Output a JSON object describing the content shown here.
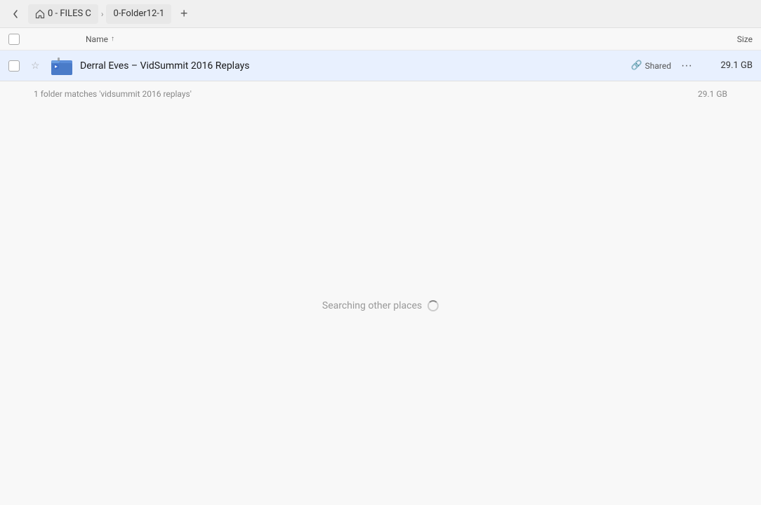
{
  "topbar": {
    "back_button_label": "←",
    "breadcrumbs": [
      {
        "id": "bc1",
        "label": "0 - FILES C"
      },
      {
        "id": "bc2",
        "label": "0-Folder12-1"
      }
    ],
    "add_tab_label": "+"
  },
  "columns": {
    "name_label": "Name",
    "sort_arrow": "↑",
    "size_label": "Size"
  },
  "file_row": {
    "name": "Derral Eves – VidSummit 2016 Replays",
    "shared_label": "Shared",
    "more_label": "···",
    "size": "29.1 GB"
  },
  "search_info": {
    "text": "1 folder matches 'vidsummit 2016 replays'",
    "size": "29.1 GB"
  },
  "searching": {
    "label": "Searching other places"
  }
}
